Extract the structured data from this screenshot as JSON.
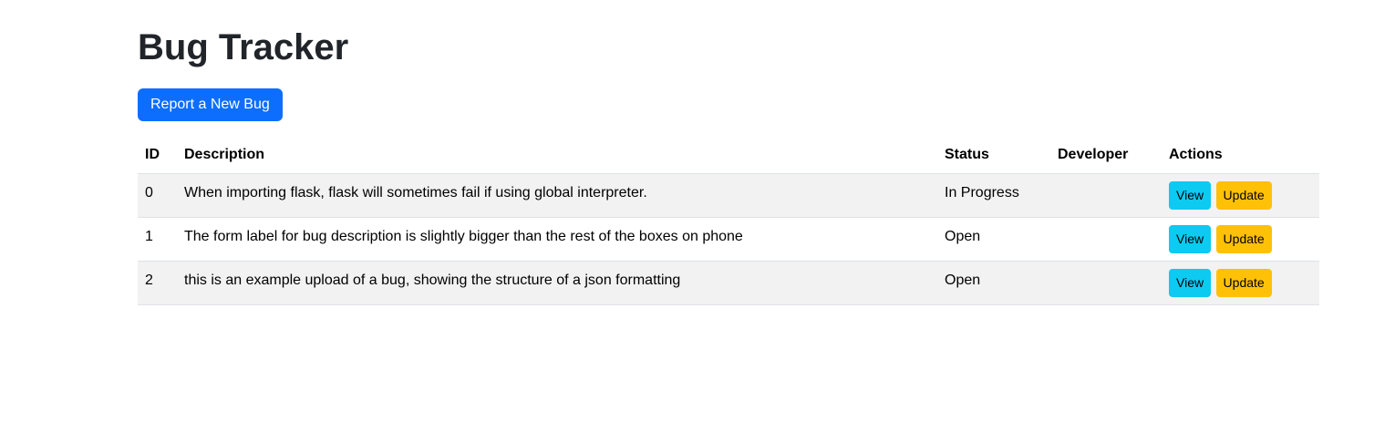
{
  "header": {
    "title": "Bug Tracker"
  },
  "actions": {
    "report_label": "Report a New Bug"
  },
  "table": {
    "columns": [
      "ID",
      "Description",
      "Status",
      "Developer",
      "Actions"
    ],
    "rows": [
      {
        "id": "0",
        "description": "When importing flask, flask will sometimes fail if using global interpreter.",
        "status": "In Progress",
        "developer": "",
        "view_label": "View",
        "update_label": "Update"
      },
      {
        "id": "1",
        "description": "The form label for bug description is slightly bigger than the rest of the boxes on phone",
        "status": "Open",
        "developer": "",
        "view_label": "View",
        "update_label": "Update"
      },
      {
        "id": "2",
        "description": "this is an example upload of a bug, showing the structure of a json formatting",
        "status": "Open",
        "developer": "",
        "view_label": "View",
        "update_label": "Update"
      }
    ]
  },
  "colors": {
    "primary": "#0d6efd",
    "info": "#0dcaf0",
    "warning": "#ffc107",
    "stripe": "#f2f2f2"
  }
}
